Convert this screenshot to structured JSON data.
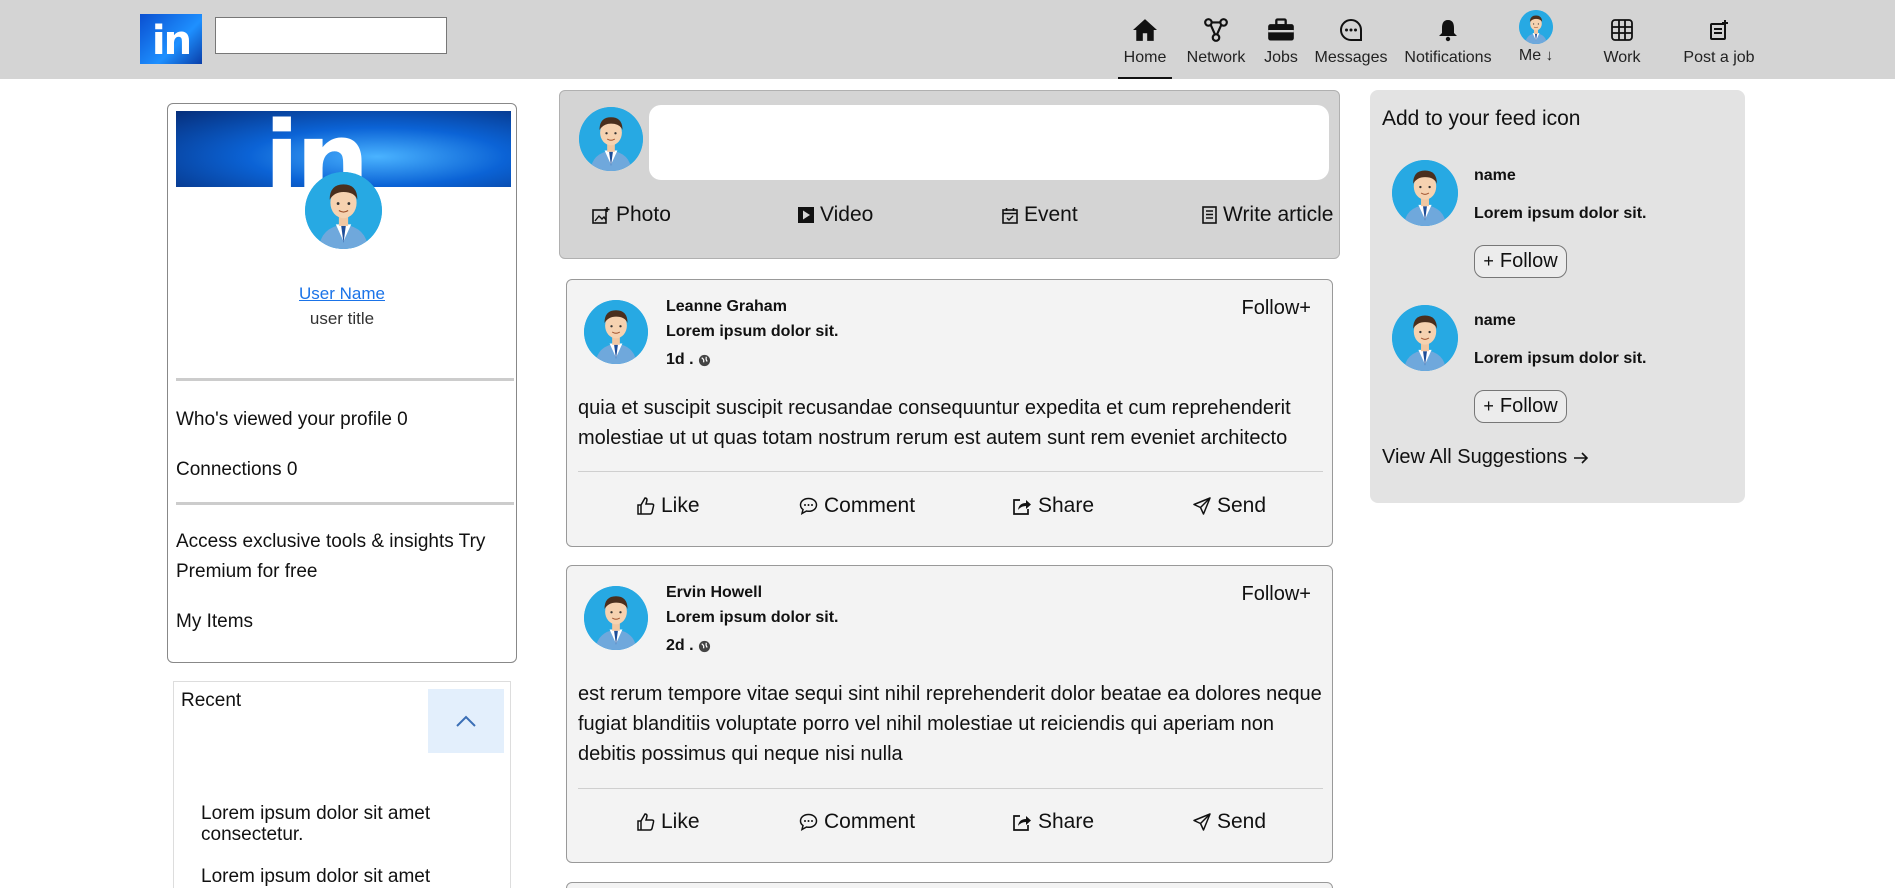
{
  "header": {
    "logo_text": "in",
    "search": {
      "value": "",
      "placeholder": ""
    },
    "nav": [
      {
        "label": "Home",
        "icon": "home-icon",
        "active": true
      },
      {
        "label": "Network",
        "icon": "network-icon"
      },
      {
        "label": "Jobs",
        "icon": "briefcase-icon"
      },
      {
        "label": "Messages",
        "icon": "message-icon"
      },
      {
        "label": "Notifications",
        "icon": "bell-icon"
      },
      {
        "label": "Me",
        "icon": "avatar"
      },
      {
        "label": "Work",
        "icon": "grid-icon"
      },
      {
        "label": "Post a job",
        "icon": "post-job-icon"
      }
    ]
  },
  "profile": {
    "banner_text": "in",
    "name": "User Name",
    "title": "user title",
    "viewed": "Who's viewed your profile 0",
    "connections": "Connections 0",
    "premium": "Access exclusive tools & insights Try Premium for free",
    "my_items": "My Items"
  },
  "recent": {
    "title": "Recent",
    "items": [
      "Lorem ipsum dolor sit amet consectetur.",
      "Lorem ipsum dolor sit amet"
    ]
  },
  "composer": {
    "input_value": "",
    "actions": [
      {
        "label": "Photo",
        "icon": "photo-icon"
      },
      {
        "label": "Video",
        "icon": "video-icon"
      },
      {
        "label": "Event",
        "icon": "calendar-icon"
      },
      {
        "label": "Write article",
        "icon": "article-icon"
      }
    ]
  },
  "posts": [
    {
      "author": "Leanne Graham",
      "subtitle": "Lorem ipsum dolor sit.",
      "time": "1d .",
      "follow": "Follow+",
      "body": "quia et suscipit suscipit recusandae consequuntur expedita et cum reprehenderit molestiae ut ut quas totam nostrum rerum est autem sunt rem eveniet architecto"
    },
    {
      "author": "Ervin Howell",
      "subtitle": "Lorem ipsum dolor sit.",
      "time": "2d .",
      "follow": "Follow+",
      "body": "est rerum tempore vitae sequi sint nihil reprehenderit dolor beatae ea dolores neque fugiat blanditiis voluptate porro vel nihil molestiae ut reiciendis qui aperiam non debitis possimus qui neque nisi nulla"
    }
  ],
  "post_actions": [
    {
      "label": "Like",
      "icon": "thumbs-up-icon"
    },
    {
      "label": "Comment",
      "icon": "comment-icon"
    },
    {
      "label": "Share",
      "icon": "share-icon"
    },
    {
      "label": "Send",
      "icon": "send-icon"
    }
  ],
  "suggestions": {
    "title": "Add to your feed icon",
    "items": [
      {
        "name": "name",
        "desc": "Lorem ipsum dolor sit.",
        "follow": "Follow"
      },
      {
        "name": "name",
        "desc": "Lorem ipsum dolor sit.",
        "follow": "Follow"
      }
    ],
    "view_all": "View All Suggestions"
  },
  "colors": {
    "topbar": "#d4d4d4",
    "link": "#1a73e8",
    "card": "#f3f3f3",
    "avatar_bg": "#27a9e3",
    "recent_toggle": "#e3effc"
  }
}
